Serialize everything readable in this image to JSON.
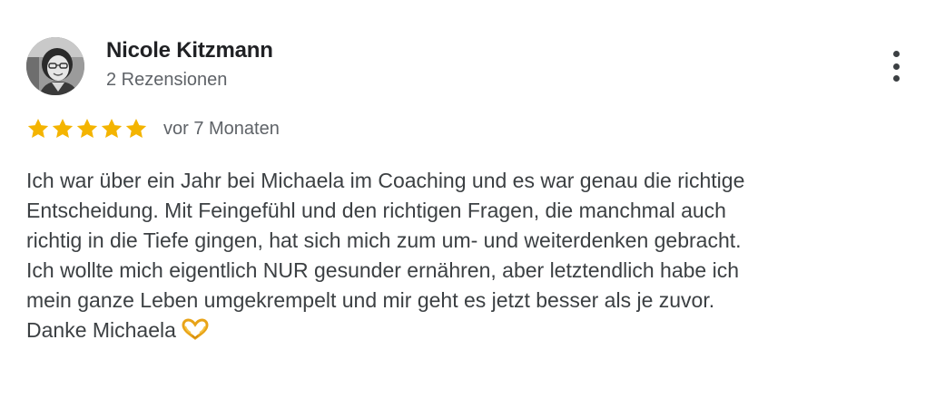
{
  "reviewer": {
    "name": "Nicole Kitzmann",
    "review_count": "2 Rezensionen",
    "avatar_icon": "user-photo"
  },
  "rating": {
    "stars": 5,
    "max_stars": 5,
    "star_color": "#F4B400",
    "date": "vor 7 Monaten"
  },
  "review": {
    "lines": [
      "Ich war über ein Jahr bei Michaela im Coaching und es war genau die richtige",
      "Entscheidung. Mit Feingefühl und den richtigen Fragen, die manchmal auch",
      "richtig in die Tiefe gingen, hat sich mich zum um- und weiterdenken gebracht.",
      "Ich wollte mich eigentlich NUR gesunder ernähren, aber letztendlich habe ich",
      "mein ganze Leben umgekrempelt und mir geht es jetzt besser als je zuvor.",
      "Danke Michaela"
    ],
    "emoji": "heart-hands-icon"
  },
  "menu": {
    "icon": "more-vert-icon"
  }
}
